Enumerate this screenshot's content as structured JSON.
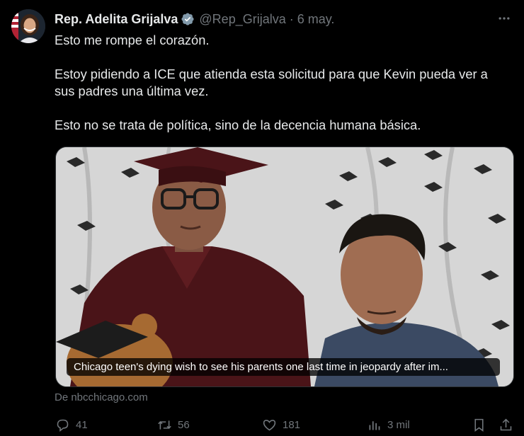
{
  "author": {
    "name": "Rep. Adelita Grijalva",
    "handle": "@Rep_Grijalva",
    "separator": "·",
    "date": "6 may.",
    "verified_color": "#829aab"
  },
  "tweet": {
    "paragraphs": [
      "Esto me rompe el corazón.",
      "Estoy pidiendo a ICE que atienda esta solicitud para que Kevin pueda ver a sus padres una última vez.",
      "Esto no se trata de política, sino de la decencia humana básica."
    ]
  },
  "card": {
    "caption": "Chicago teen's dying wish to see his parents one last time in jeopardy after im...",
    "source": "De nbcchicago.com"
  },
  "actions": {
    "replies": "41",
    "reposts": "56",
    "likes": "181",
    "views": "3 mil"
  },
  "icons": [
    "verified-badge-icon",
    "more-icon",
    "reply-icon",
    "repost-icon",
    "like-icon",
    "views-icon",
    "bookmark-icon",
    "share-icon"
  ],
  "colors": {
    "background": "#000000",
    "text": "#e7e9ea",
    "secondary": "#71767b",
    "border": "#2f3336"
  }
}
